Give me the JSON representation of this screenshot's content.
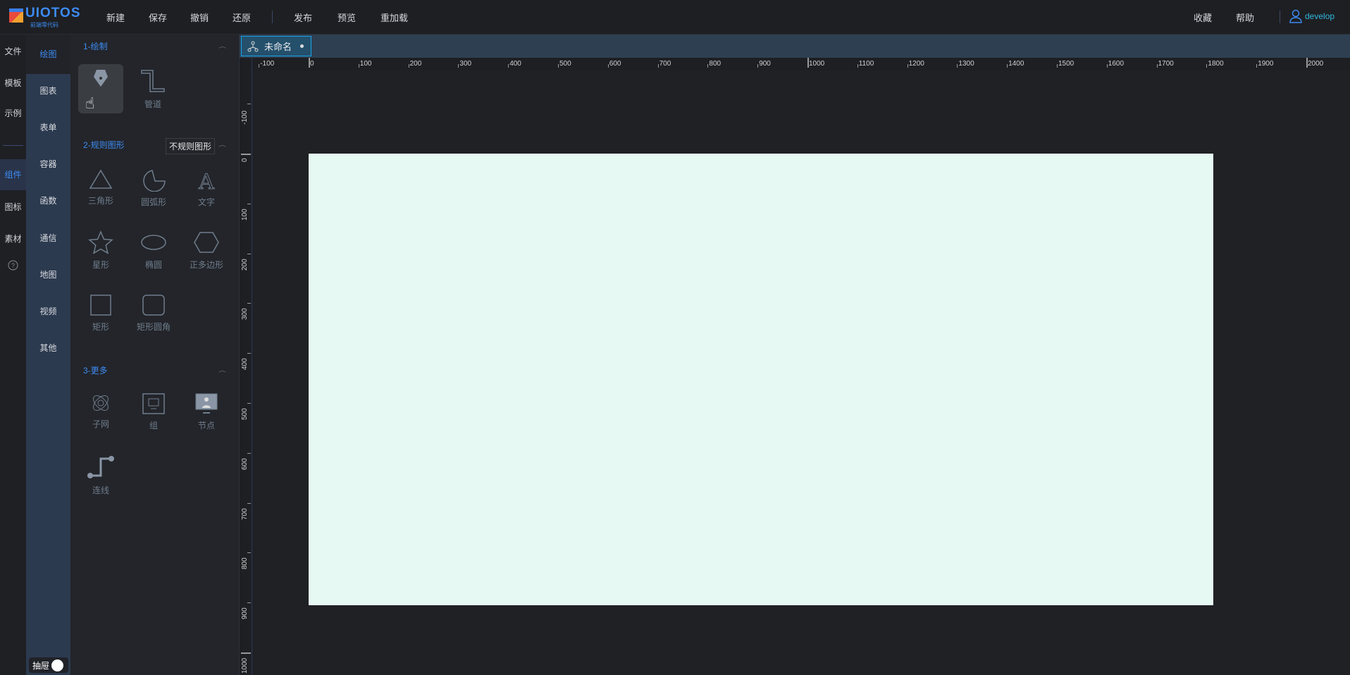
{
  "header": {
    "logo_name": "UIOTOS",
    "logo_sub": "前端零代码",
    "nav_left": [
      "新建",
      "保存",
      "撤销",
      "还原"
    ],
    "nav_right": [
      "发布",
      "预览",
      "重加载"
    ],
    "fav": "收藏",
    "help": "帮助",
    "user": "develop"
  },
  "col1": {
    "items": [
      "文件",
      "模板",
      "示例"
    ],
    "items2": [
      "组件",
      "图标",
      "素材"
    ],
    "active": "组件"
  },
  "col2": {
    "items": [
      "绘图",
      "图表",
      "表单",
      "容器",
      "函数",
      "通信",
      "地图",
      "视频",
      "其他"
    ],
    "active": "绘图",
    "drawer": "抽屉"
  },
  "panel": {
    "sections": [
      {
        "title": "1-绘制",
        "items": [
          "不规则图形",
          "管道"
        ]
      },
      {
        "title": "2-规则图形",
        "items": [
          "三角形",
          "圆弧形",
          "文字",
          "星形",
          "椭圆",
          "正多边形",
          "矩形",
          "矩形圆角"
        ]
      },
      {
        "title": "3-更多",
        "items": [
          "子网",
          "组",
          "节点",
          "连线"
        ]
      }
    ],
    "tooltip": "不规则图形"
  },
  "tab": {
    "title": "未命名"
  },
  "rulers": {
    "h_labels": [
      -100,
      0,
      100,
      200,
      300,
      400,
      500,
      600,
      700,
      800,
      900,
      1000,
      1100,
      1200,
      1300,
      1400,
      1500,
      1600,
      1700,
      1800,
      1900,
      2000
    ],
    "v_labels": [
      -100,
      0,
      100,
      200,
      300,
      400,
      500,
      600,
      700,
      800,
      900,
      1000
    ]
  },
  "colors": {
    "accent": "#3d8bf2",
    "canvas": "#e6f9f3",
    "tab_border": "#1aa3e8"
  }
}
